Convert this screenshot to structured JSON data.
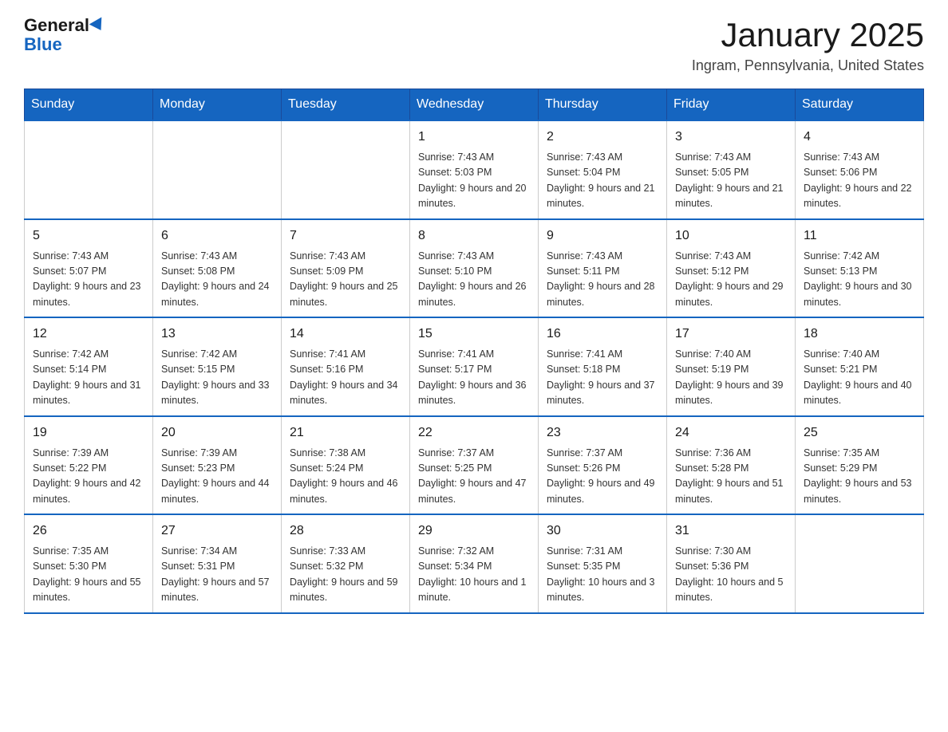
{
  "logo": {
    "general": "General",
    "blue": "Blue"
  },
  "header": {
    "title": "January 2025",
    "subtitle": "Ingram, Pennsylvania, United States"
  },
  "days": [
    "Sunday",
    "Monday",
    "Tuesday",
    "Wednesday",
    "Thursday",
    "Friday",
    "Saturday"
  ],
  "weeks": [
    [
      {
        "day": "",
        "info": ""
      },
      {
        "day": "",
        "info": ""
      },
      {
        "day": "",
        "info": ""
      },
      {
        "day": "1",
        "info": "Sunrise: 7:43 AM\nSunset: 5:03 PM\nDaylight: 9 hours\nand 20 minutes."
      },
      {
        "day": "2",
        "info": "Sunrise: 7:43 AM\nSunset: 5:04 PM\nDaylight: 9 hours\nand 21 minutes."
      },
      {
        "day": "3",
        "info": "Sunrise: 7:43 AM\nSunset: 5:05 PM\nDaylight: 9 hours\nand 21 minutes."
      },
      {
        "day": "4",
        "info": "Sunrise: 7:43 AM\nSunset: 5:06 PM\nDaylight: 9 hours\nand 22 minutes."
      }
    ],
    [
      {
        "day": "5",
        "info": "Sunrise: 7:43 AM\nSunset: 5:07 PM\nDaylight: 9 hours\nand 23 minutes."
      },
      {
        "day": "6",
        "info": "Sunrise: 7:43 AM\nSunset: 5:08 PM\nDaylight: 9 hours\nand 24 minutes."
      },
      {
        "day": "7",
        "info": "Sunrise: 7:43 AM\nSunset: 5:09 PM\nDaylight: 9 hours\nand 25 minutes."
      },
      {
        "day": "8",
        "info": "Sunrise: 7:43 AM\nSunset: 5:10 PM\nDaylight: 9 hours\nand 26 minutes."
      },
      {
        "day": "9",
        "info": "Sunrise: 7:43 AM\nSunset: 5:11 PM\nDaylight: 9 hours\nand 28 minutes."
      },
      {
        "day": "10",
        "info": "Sunrise: 7:43 AM\nSunset: 5:12 PM\nDaylight: 9 hours\nand 29 minutes."
      },
      {
        "day": "11",
        "info": "Sunrise: 7:42 AM\nSunset: 5:13 PM\nDaylight: 9 hours\nand 30 minutes."
      }
    ],
    [
      {
        "day": "12",
        "info": "Sunrise: 7:42 AM\nSunset: 5:14 PM\nDaylight: 9 hours\nand 31 minutes."
      },
      {
        "day": "13",
        "info": "Sunrise: 7:42 AM\nSunset: 5:15 PM\nDaylight: 9 hours\nand 33 minutes."
      },
      {
        "day": "14",
        "info": "Sunrise: 7:41 AM\nSunset: 5:16 PM\nDaylight: 9 hours\nand 34 minutes."
      },
      {
        "day": "15",
        "info": "Sunrise: 7:41 AM\nSunset: 5:17 PM\nDaylight: 9 hours\nand 36 minutes."
      },
      {
        "day": "16",
        "info": "Sunrise: 7:41 AM\nSunset: 5:18 PM\nDaylight: 9 hours\nand 37 minutes."
      },
      {
        "day": "17",
        "info": "Sunrise: 7:40 AM\nSunset: 5:19 PM\nDaylight: 9 hours\nand 39 minutes."
      },
      {
        "day": "18",
        "info": "Sunrise: 7:40 AM\nSunset: 5:21 PM\nDaylight: 9 hours\nand 40 minutes."
      }
    ],
    [
      {
        "day": "19",
        "info": "Sunrise: 7:39 AM\nSunset: 5:22 PM\nDaylight: 9 hours\nand 42 minutes."
      },
      {
        "day": "20",
        "info": "Sunrise: 7:39 AM\nSunset: 5:23 PM\nDaylight: 9 hours\nand 44 minutes."
      },
      {
        "day": "21",
        "info": "Sunrise: 7:38 AM\nSunset: 5:24 PM\nDaylight: 9 hours\nand 46 minutes."
      },
      {
        "day": "22",
        "info": "Sunrise: 7:37 AM\nSunset: 5:25 PM\nDaylight: 9 hours\nand 47 minutes."
      },
      {
        "day": "23",
        "info": "Sunrise: 7:37 AM\nSunset: 5:26 PM\nDaylight: 9 hours\nand 49 minutes."
      },
      {
        "day": "24",
        "info": "Sunrise: 7:36 AM\nSunset: 5:28 PM\nDaylight: 9 hours\nand 51 minutes."
      },
      {
        "day": "25",
        "info": "Sunrise: 7:35 AM\nSunset: 5:29 PM\nDaylight: 9 hours\nand 53 minutes."
      }
    ],
    [
      {
        "day": "26",
        "info": "Sunrise: 7:35 AM\nSunset: 5:30 PM\nDaylight: 9 hours\nand 55 minutes."
      },
      {
        "day": "27",
        "info": "Sunrise: 7:34 AM\nSunset: 5:31 PM\nDaylight: 9 hours\nand 57 minutes."
      },
      {
        "day": "28",
        "info": "Sunrise: 7:33 AM\nSunset: 5:32 PM\nDaylight: 9 hours\nand 59 minutes."
      },
      {
        "day": "29",
        "info": "Sunrise: 7:32 AM\nSunset: 5:34 PM\nDaylight: 10 hours\nand 1 minute."
      },
      {
        "day": "30",
        "info": "Sunrise: 7:31 AM\nSunset: 5:35 PM\nDaylight: 10 hours\nand 3 minutes."
      },
      {
        "day": "31",
        "info": "Sunrise: 7:30 AM\nSunset: 5:36 PM\nDaylight: 10 hours\nand 5 minutes."
      },
      {
        "day": "",
        "info": ""
      }
    ]
  ]
}
